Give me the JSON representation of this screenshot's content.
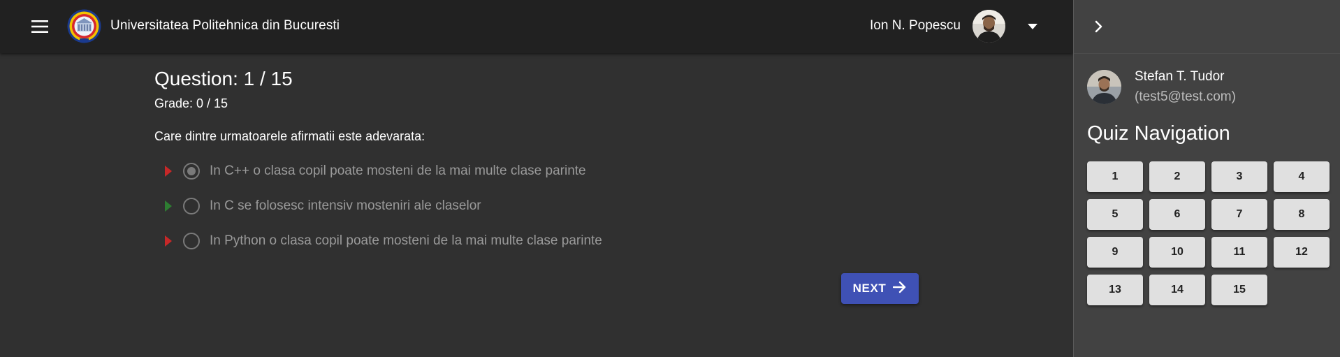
{
  "header": {
    "menu_icon": "menu-icon",
    "logo_icon": "university-logo-icon",
    "university_name": "Universitatea Politehnica din Bucuresti",
    "user_name": "Ion N. Popescu",
    "dropdown_icon": "caret-down-icon",
    "background": "#212121"
  },
  "quiz": {
    "question_label": "Question: 1 / 15",
    "grade_label": "Grade: 0 / 15",
    "question_text": "Care dintre urmatoarele afirmatii este adevarata:",
    "answers": [
      {
        "label": "In C++ o clasa copil poate mosteni de la mai multe clase parinte",
        "selected": true,
        "marker": "wrong",
        "marker_color": "#c62828"
      },
      {
        "label": "In C se folosesc intensiv mosteniri ale claselor",
        "selected": false,
        "marker": "correct",
        "marker_color": "#2e7d32"
      },
      {
        "label": "In Python o clasa copil poate mosteni de la mai multe clase parinte",
        "selected": false,
        "marker": "wrong",
        "marker_color": "#c62828"
      }
    ],
    "next_label": "NEXT",
    "next_icon": "arrow-right-icon",
    "accent": "#3f51b5"
  },
  "sidebar": {
    "collapse_icon": "chevron-right-icon",
    "student_name": "Stefan T. Tudor",
    "student_email": "(test5@test.com)",
    "nav_title": "Quiz Navigation",
    "questions": [
      "1",
      "2",
      "3",
      "4",
      "5",
      "6",
      "7",
      "8",
      "9",
      "10",
      "11",
      "12",
      "13",
      "14",
      "15"
    ],
    "background": "#424242"
  }
}
